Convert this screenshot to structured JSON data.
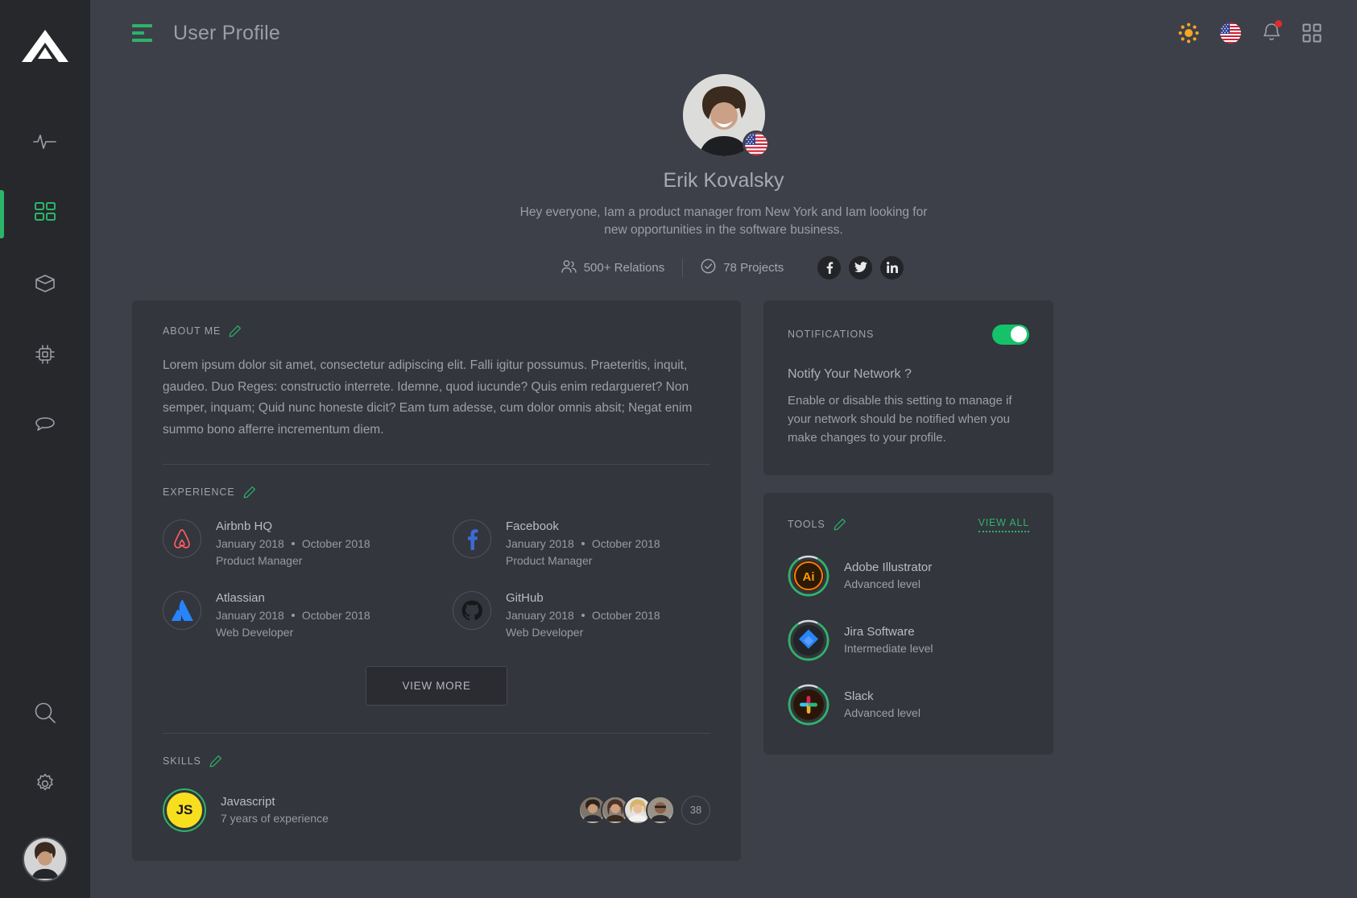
{
  "brand": {
    "logo_icon": "triangle-logo"
  },
  "colors": {
    "accent_green": "#2cb46a",
    "toggle_on": "#15c26a",
    "panel": "#33363c",
    "page_bg": "#3d4049",
    "rail_bg": "#26282c",
    "badge_red": "#e02b2b",
    "sun_orange": "#f5a623",
    "js_yellow": "#f7df1e"
  },
  "sidebar": {
    "items": [
      {
        "icon": "activity-pulse-icon",
        "active": false
      },
      {
        "icon": "grid-dashboard-icon",
        "active": true
      },
      {
        "icon": "box-cube-icon",
        "active": false
      },
      {
        "icon": "cpu-chip-icon",
        "active": false
      },
      {
        "icon": "chat-bubble-icon",
        "active": false
      }
    ],
    "bottom_items": [
      {
        "icon": "search-icon"
      },
      {
        "icon": "gear-icon"
      }
    ],
    "avatar_name": "user-avatar"
  },
  "topbar": {
    "menu_icon": "hamburger-menu-icon",
    "title": "User Profile",
    "actions": [
      {
        "icon": "sun-brightness-icon"
      },
      {
        "icon": "us-flag-icon"
      },
      {
        "icon": "bell-notification-icon",
        "has_badge": true
      },
      {
        "icon": "apps-grid-icon"
      }
    ]
  },
  "profile": {
    "name": "Erik Kovalsky",
    "bio": "Hey everyone,  Iam a product manager from New York and Iam looking for new opportunities in the software business.",
    "flag_icon": "us-flag-icon",
    "stats": [
      {
        "icon": "users-group-icon",
        "label": "500+ Relations"
      },
      {
        "icon": "check-circle-icon",
        "label": "78 Projects"
      }
    ],
    "socials": [
      {
        "icon": "facebook-icon"
      },
      {
        "icon": "twitter-icon"
      },
      {
        "icon": "linkedin-icon"
      }
    ]
  },
  "about": {
    "title": "ABOUT ME",
    "edit_icon": "pencil-edit-icon",
    "text": "Lorem ipsum dolor sit amet, consectetur adipiscing elit. Falli igitur possumus. Praeteritis, inquit, gaudeo. Duo Reges: constructio interrete. Idemne, quod iucunde? Quis enim redargueret? Non semper, inquam; Quid nunc honeste dicit? Eam tum adesse, cum dolor omnis absit; Negat enim summo bono afferre incrementum diem."
  },
  "experience": {
    "title": "EXPERIENCE",
    "edit_icon": "pencil-edit-icon",
    "view_more_label": "VIEW MORE",
    "items": [
      {
        "company": "Airbnb HQ",
        "logo": "airbnb-logo-icon",
        "start": "January 2018",
        "end": "October 2018",
        "role": "Product Manager"
      },
      {
        "company": "Facebook",
        "logo": "facebook-logo-icon",
        "start": "January 2018",
        "end": "October 2018",
        "role": "Product Manager"
      },
      {
        "company": "Atlassian",
        "logo": "atlassian-logo-icon",
        "start": "January 2018",
        "end": "October 2018",
        "role": "Web Developer"
      },
      {
        "company": "GitHub",
        "logo": "github-logo-icon",
        "start": "January 2018",
        "end": "October 2018",
        "role": "Web Developer"
      }
    ]
  },
  "skills": {
    "title": "SKILLS",
    "edit_icon": "pencil-edit-icon",
    "items": [
      {
        "badge_text": "JS",
        "name": "Javascript",
        "experience": "7 years of experience"
      }
    ],
    "endorsers_count": "38",
    "endorser_avatars": [
      "endorser-avatar-1",
      "endorser-avatar-2",
      "endorser-avatar-3",
      "endorser-avatar-4"
    ]
  },
  "notifications": {
    "title": "NOTIFICATIONS",
    "toggle_on": true,
    "question": "Notify Your Network ?",
    "description": "Enable or disable this setting to manage if your network should be notified when you make changes to your profile."
  },
  "tools": {
    "title": "TOOLS",
    "edit_icon": "pencil-edit-icon",
    "view_all_label": "VIEW ALL",
    "items": [
      {
        "name": "Adobe Illustrator",
        "level": "Advanced level",
        "icon": "adobe-illustrator-icon",
        "progress": 82
      },
      {
        "name": "Jira Software",
        "level": "Intermediate level",
        "icon": "jira-software-icon",
        "progress": 82
      },
      {
        "name": "Slack",
        "level": "Advanced level",
        "icon": "slack-icon",
        "progress": 82
      }
    ]
  }
}
